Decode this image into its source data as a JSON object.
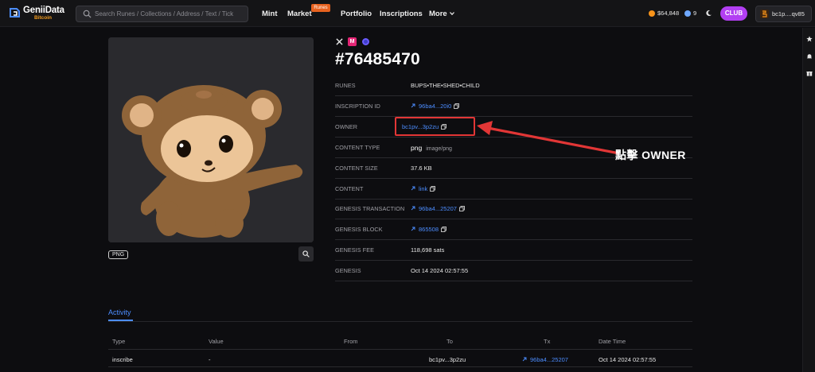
{
  "header": {
    "logo_name": "GeniiData",
    "logo_sub": "Bitcoin",
    "search_placeholder": "Search Runes / Collections / Address / Text / Tick",
    "nav": {
      "mint": "Mint",
      "market": "Market",
      "market_badge": "Runes",
      "portfolio": "Portfolio",
      "inscriptions": "Inscriptions",
      "more": "More"
    },
    "btc_price": "$64,848",
    "gas": "9",
    "club_label": "CLUB",
    "wallet": "bc1p....qv85"
  },
  "inscription": {
    "number": "#76485470",
    "media_badge": "PNG",
    "rows": [
      {
        "label": "RUNES",
        "value": "BUPS•THE•SHED•CHILD"
      },
      {
        "label": "INSCRIPTION ID",
        "value": "96ba4...20i0"
      },
      {
        "label": "OWNER",
        "value": "bc1pv...3p2zu"
      },
      {
        "label": "CONTENT TYPE",
        "value": "png",
        "extra": "image/png"
      },
      {
        "label": "CONTENT SIZE",
        "value": "37.6 KB"
      },
      {
        "label": "CONTENT",
        "value": "link"
      },
      {
        "label": "GENESIS TRANSACTION",
        "value": "96ba4...25207"
      },
      {
        "label": "GENESIS BLOCK",
        "value": "865508"
      },
      {
        "label": "GENESIS FEE",
        "value": "118,698 sats"
      },
      {
        "label": "GENESIS",
        "value": "Oct 14 2024 02:57:55"
      }
    ]
  },
  "annotation": {
    "text": "點擊 OWNER",
    "color": "#e23636"
  },
  "activity": {
    "tab": "Activity",
    "columns": [
      "Type",
      "Value",
      "From",
      "To",
      "Tx",
      "Date Time"
    ],
    "rows": [
      {
        "type": "inscribe",
        "value": "-",
        "from": "",
        "to": "bc1pv...3p2zu",
        "tx": "96ba4...25207",
        "date": "Oct 14 2024 02:57:55"
      }
    ]
  },
  "colors": {
    "accent": "#4c8dff",
    "club": "#b23ff2",
    "btc": "#f7931a",
    "badge": "#e8621f"
  },
  "icons": [
    "search-icon",
    "chevron-down-icon",
    "moon-icon",
    "star-icon",
    "bell-icon",
    "gift-icon",
    "copy-icon",
    "arrow-up-right-icon",
    "zoom-icon",
    "x-icon"
  ]
}
